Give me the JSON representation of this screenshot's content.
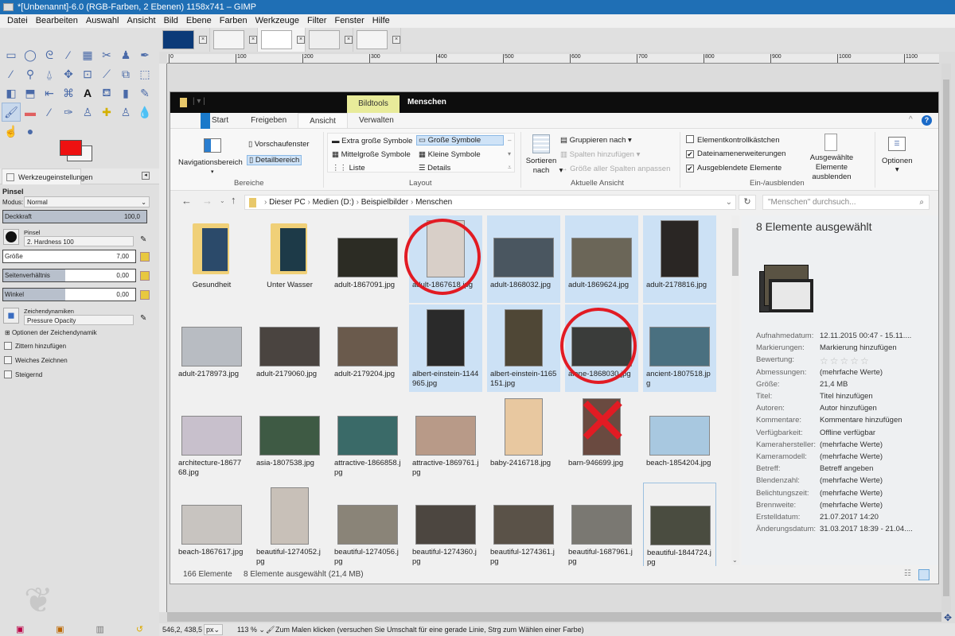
{
  "window": {
    "title": "*[Unbenannt]-6.0 (RGB-Farben, 2 Ebenen) 1158x741 – GIMP"
  },
  "menu": [
    "Datei",
    "Bearbeiten",
    "Auswahl",
    "Ansicht",
    "Bild",
    "Ebene",
    "Farben",
    "Werkzeuge",
    "Filter",
    "Fenster",
    "Hilfe"
  ],
  "image_tabs": [
    {
      "name": "image-tab-1",
      "active": false
    },
    {
      "name": "image-tab-2",
      "active": false
    },
    {
      "name": "image-tab-3",
      "active": true
    },
    {
      "name": "image-tab-4",
      "active": false
    },
    {
      "name": "image-tab-5",
      "active": false
    }
  ],
  "toolbox": {
    "tools": [
      "rect-select",
      "ellipse-select",
      "free-select",
      "fuzzy-select",
      "color-select",
      "scissors-select",
      "foreground-select",
      "paths",
      "color-picker",
      "zoom",
      "measure",
      "move",
      "align",
      "crop",
      "unified-transform",
      "perspective",
      "flip",
      "cage",
      "warp",
      "handle-transform",
      "text",
      "bucket-fill",
      "blend",
      "pencil",
      "paintbrush",
      "eraser",
      "airbrush",
      "ink",
      "clone",
      "heal",
      "perspective-clone",
      "blur",
      "smudge",
      "dodge-burn"
    ],
    "selected_tool": "paintbrush",
    "fg_color": "#ee1111",
    "bg_color": "#f6f6f6"
  },
  "tool_options": {
    "tab_label": "Werkzeugeinstellungen",
    "title": "Pinsel",
    "mode_label": "Modus:",
    "mode_value": "Normal",
    "opacity_label": "Deckkraft",
    "opacity_value": "100,0",
    "brush_label": "Pinsel",
    "brush_value": "2. Hardness 100",
    "size_label": "Größe",
    "size_value": "7,00",
    "aspect_label": "Seitenverhältnis",
    "aspect_value": "0,00",
    "angle_label": "Winkel",
    "angle_value": "0,00",
    "dynamics_label": "Zeichendynamiken",
    "dynamics_value": "Pressure Opacity",
    "dynamics_options": "Optionen der Zeichendynamik",
    "jitter": "Zittern hinzufügen",
    "smooth": "Weiches Zeichnen",
    "incremental": "Steigernd"
  },
  "ruler": {
    "h_ticks": [
      "0",
      "100",
      "200",
      "300",
      "400",
      "500",
      "600",
      "700",
      "800",
      "900",
      "1000",
      "1100"
    ]
  },
  "explorer": {
    "context_tab": "Bildtools",
    "window_title": "Menschen",
    "ribbon_tabs": [
      "Start",
      "Freigeben",
      "Ansicht",
      "Verwalten"
    ],
    "active_tab": "Ansicht",
    "ribbon": {
      "bereiche": {
        "label": "Bereiche",
        "nav": "Navigationsbereich",
        "preview": "Vorschaufenster",
        "details": "Detailbereich"
      },
      "layout": {
        "label": "Layout",
        "items": [
          "Extra große Symbole",
          "Große Symbole",
          "Mittelgroße Symbole",
          "Kleine Symbole",
          "Liste",
          "Details"
        ],
        "selected": "Große Symbole"
      },
      "aktuelle_ansicht": {
        "label": "Aktuelle Ansicht",
        "sort": "Sortieren nach",
        "group": "Gruppieren nach",
        "add_cols": "Spalten hinzufügen",
        "fit_cols": "Größe aller Spalten anpassen"
      },
      "ein_aus": {
        "label": "Ein-/ausblenden",
        "item_checkboxes": {
          "label": "Elementkontrollkästchen",
          "checked": false
        },
        "extensions": {
          "label": "Dateinamenerweiterungen",
          "checked": true
        },
        "hidden": {
          "label": "Ausgeblendete Elemente",
          "checked": true
        },
        "hide_selected": "Ausgewählte Elemente ausblenden"
      },
      "options": "Optionen"
    },
    "breadcrumb": [
      "Dieser PC",
      "Medien (D:)",
      "Beispielbilder",
      "Menschen"
    ],
    "search_placeholder": "\"Menschen\" durchsuch...",
    "files": [
      {
        "name": "Gesundheit",
        "type": "folder",
        "selected": false
      },
      {
        "name": "Unter Wasser",
        "type": "folder",
        "selected": false
      },
      {
        "name": "adult-1867091.jpg",
        "type": "image",
        "selected": false
      },
      {
        "name": "adult-1867618.jpg",
        "type": "image",
        "selected": true,
        "annotation": "circle"
      },
      {
        "name": "adult-1868032.jpg",
        "type": "image",
        "selected": true
      },
      {
        "name": "adult-1869624.jpg",
        "type": "image",
        "selected": true
      },
      {
        "name": "adult-2178816.jpg",
        "type": "image",
        "selected": true
      },
      {
        "name": "adult-2178973.jpg",
        "type": "image",
        "selected": false
      },
      {
        "name": "adult-2179060.jpg",
        "type": "image",
        "selected": false
      },
      {
        "name": "adult-2179204.jpg",
        "type": "image",
        "selected": false
      },
      {
        "name": "albert-einstein-1144965.jpg",
        "type": "image",
        "selected": true
      },
      {
        "name": "albert-einstein-1165151.jpg",
        "type": "image",
        "selected": true
      },
      {
        "name": "alone-1868030.jpg",
        "type": "image",
        "selected": true,
        "annotation": "circle"
      },
      {
        "name": "ancient-1807518.jpg",
        "type": "image",
        "selected": true
      },
      {
        "name": "architecture-1867768.jpg",
        "type": "image",
        "selected": false
      },
      {
        "name": "asia-1807538.jpg",
        "type": "image",
        "selected": false
      },
      {
        "name": "attractive-1866858.jpg",
        "type": "image",
        "selected": false
      },
      {
        "name": "attractive-1869761.jpg",
        "type": "image",
        "selected": false
      },
      {
        "name": "baby-2416718.jpg",
        "type": "image",
        "selected": false
      },
      {
        "name": "barn-946699.jpg",
        "type": "image",
        "selected": false,
        "annotation": "cross"
      },
      {
        "name": "beach-1854204.jpg",
        "type": "image",
        "selected": false
      },
      {
        "name": "beach-1867617.jpg",
        "type": "image",
        "selected": false
      },
      {
        "name": "beautiful-1274052.jpg",
        "type": "image",
        "selected": false
      },
      {
        "name": "beautiful-1274056.jpg",
        "type": "image",
        "selected": false
      },
      {
        "name": "beautiful-1274360.jpg",
        "type": "image",
        "selected": false
      },
      {
        "name": "beautiful-1274361.jpg",
        "type": "image",
        "selected": false
      },
      {
        "name": "beautiful-1687961.jpg",
        "type": "image",
        "selected": false
      },
      {
        "name": "beautiful-1844724.jpg",
        "type": "image",
        "selected": false,
        "focused": true
      }
    ],
    "details": {
      "header": "8 Elemente ausgewählt",
      "rating_stars": 0,
      "props": [
        {
          "k": "Aufnahmedatum:",
          "v": "12.11.2015 00:47 - 15.11...."
        },
        {
          "k": "Markierungen:",
          "v": "Markierung hinzufügen"
        },
        {
          "k": "Bewertung:",
          "v": "☆☆☆☆☆"
        },
        {
          "k": "Abmessungen:",
          "v": "(mehrfache Werte)"
        },
        {
          "k": "Größe:",
          "v": "21,4 MB"
        },
        {
          "k": "Titel:",
          "v": "Titel hinzufügen"
        },
        {
          "k": "Autoren:",
          "v": "Autor hinzufügen"
        },
        {
          "k": "Kommentare:",
          "v": "Kommentare hinzufügen"
        },
        {
          "k": "Verfügbarkeit:",
          "v": "Offline verfügbar"
        },
        {
          "k": "Kamerahersteller:",
          "v": "(mehrfache Werte)"
        },
        {
          "k": "Kameramodell:",
          "v": "(mehrfache Werte)"
        },
        {
          "k": "Betreff:",
          "v": "Betreff angeben"
        },
        {
          "k": "Blendenzahl:",
          "v": "(mehrfache Werte)"
        },
        {
          "k": "Belichtungszeit:",
          "v": "(mehrfache Werte)"
        },
        {
          "k": "Brennweite:",
          "v": "(mehrfache Werte)"
        },
        {
          "k": "Erstelldatum:",
          "v": "21.07.2017 14:20"
        },
        {
          "k": "Änderungsdatum:",
          "v": "31.03.2017 18:39 - 21.04...."
        }
      ]
    },
    "status": {
      "count": "166 Elemente",
      "selection": "8 Elemente ausgewählt (21,4 MB)"
    }
  },
  "gimp_status": {
    "coords": "546,2, 438,5",
    "unit": "px",
    "zoom": "113 %",
    "message": "Zum Malen klicken (versuchen Sie Umschalt für eine gerade Linie, Strg zum Wählen einer Farbe)"
  }
}
